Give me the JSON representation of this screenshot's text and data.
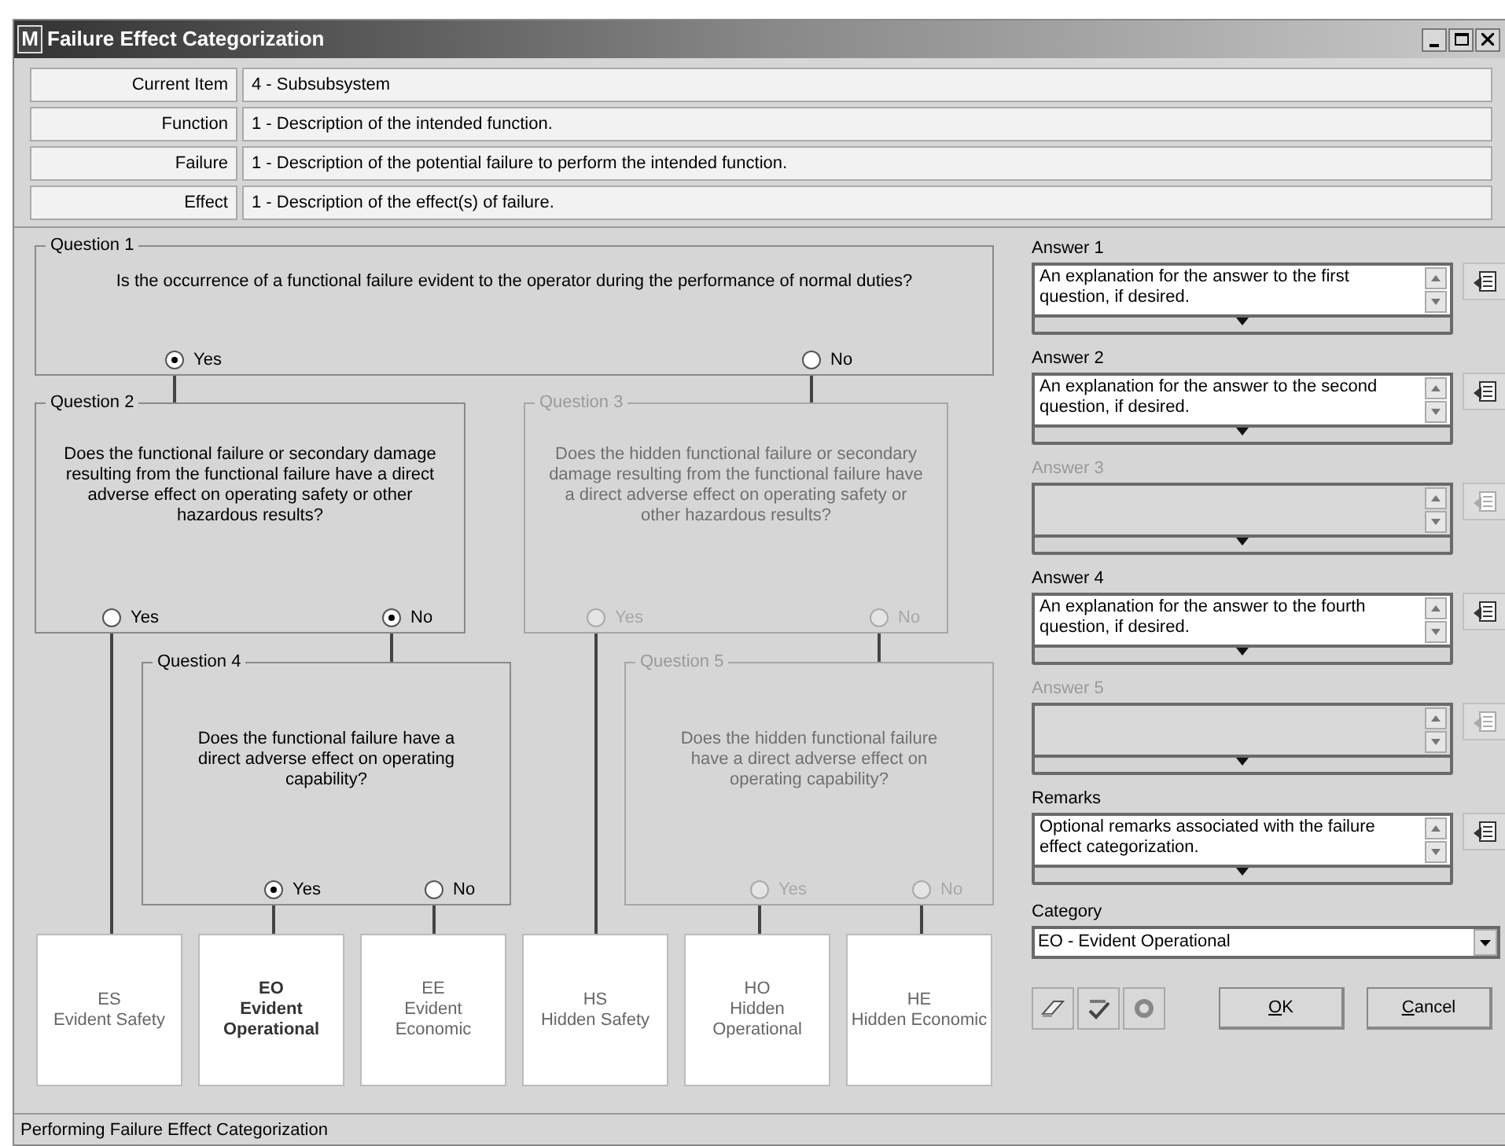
{
  "window": {
    "app_icon": "M",
    "title": "Failure Effect Categorization"
  },
  "info_rows": [
    {
      "label": "Current Item",
      "value": "4 - Subsubsystem"
    },
    {
      "label": "Function",
      "value": "1 - Description of the intended function."
    },
    {
      "label": "Failure",
      "value": "1 - Description of the potential failure to perform the intended function."
    },
    {
      "label": "Effect",
      "value": "1 - Description of the effect(s) of failure."
    }
  ],
  "questions": [
    {
      "label": "Question 1",
      "text": "Is the occurrence of a functional failure evident to the operator during the performance of normal duties?",
      "enabled": true,
      "options": [
        {
          "label": "Yes",
          "selected": true
        },
        {
          "label": "No",
          "selected": false
        }
      ]
    },
    {
      "label": "Question 2",
      "text": "Does the functional failure or secondary damage resulting from the functional failure have a direct adverse effect on operating safety or other hazardous results?",
      "enabled": true,
      "options": [
        {
          "label": "Yes",
          "selected": false
        },
        {
          "label": "No",
          "selected": true
        }
      ]
    },
    {
      "label": "Question 3",
      "text": "Does the hidden functional failure or secondary damage resulting from the functional failure have a direct adverse effect on operating safety or other hazardous results?",
      "enabled": false,
      "options": [
        {
          "label": "Yes",
          "selected": false
        },
        {
          "label": "No",
          "selected": false
        }
      ]
    },
    {
      "label": "Question 4",
      "text": "Does the functional failure have a direct adverse effect on operating capability?",
      "enabled": true,
      "options": [
        {
          "label": "Yes",
          "selected": true
        },
        {
          "label": "No",
          "selected": false
        }
      ]
    },
    {
      "label": "Question 5",
      "text": "Does the hidden functional failure have a direct adverse effect on operating capability?",
      "enabled": false,
      "options": [
        {
          "label": "Yes",
          "selected": false
        },
        {
          "label": "No",
          "selected": false
        }
      ]
    }
  ],
  "categories": [
    {
      "code": "ES",
      "name": "Evident Safety",
      "selected": false
    },
    {
      "code": "EO",
      "name": "Evident Operational",
      "selected": true
    },
    {
      "code": "EE",
      "name": "Evident Economic",
      "selected": false
    },
    {
      "code": "HS",
      "name": "Hidden Safety",
      "selected": false
    },
    {
      "code": "HO",
      "name": "Hidden Operational",
      "selected": false
    },
    {
      "code": "HE",
      "name": "Hidden Economic",
      "selected": false
    }
  ],
  "answers": [
    {
      "label": "Answer 1",
      "text": "An explanation for the answer to the first question, if desired.",
      "enabled": true
    },
    {
      "label": "Answer 2",
      "text": "An explanation for the answer to the second question, if desired.",
      "enabled": true
    },
    {
      "label": "Answer 3",
      "enabled": false
    },
    {
      "label": "Answer 4",
      "text": "An explanation for the answer to the fourth question, if desired.",
      "enabled": true
    },
    {
      "label": "Answer 5",
      "enabled": false
    },
    {
      "label": "Remarks",
      "text": "Optional remarks associated with the failure effect categorization.",
      "enabled": true
    }
  ],
  "category": {
    "label": "Category",
    "value": "EO - Evident Operational"
  },
  "buttons": [
    {
      "label": "OK"
    },
    {
      "label": "Cancel"
    }
  ],
  "status_bar": "Performing Failure Effect Categorization"
}
